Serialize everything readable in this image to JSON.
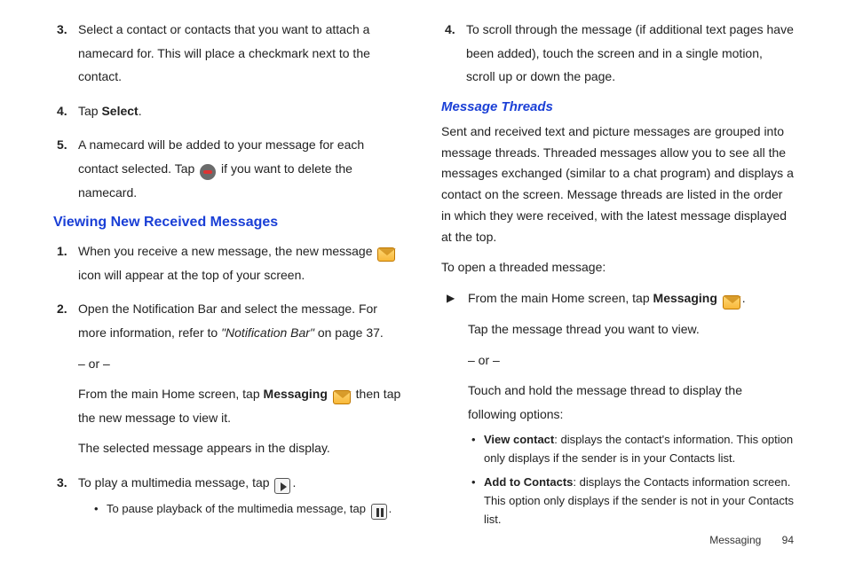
{
  "left": {
    "items123": [
      {
        "num": "3.",
        "text": "Select a contact or contacts that you want to attach a namecard for. This will place a checkmark next to the contact."
      },
      {
        "num": "4.",
        "pre": "Tap ",
        "bold": "Select",
        "post": "."
      },
      {
        "num": "5.",
        "pre": "A namecard will be added to your message for each contact selected. Tap ",
        "post": " if you want to delete the namecard."
      }
    ],
    "heading": "Viewing New Received Messages",
    "view_items": {
      "i1": {
        "num": "1.",
        "pre": "When you receive a new message, the new message ",
        "post": " icon will appear at the top of your screen."
      },
      "i2": {
        "num": "2.",
        "line1a": "Open the Notification Bar and select the message. For more information, refer to ",
        "line1b": "\"Notification Bar\"",
        "line1c": "  on page 37.",
        "or": "– or –",
        "line2a": "From the main Home screen, tap ",
        "line2b": "Messaging",
        "line2c": " then tap the new message to view it.",
        "line3": "The selected message appears in the display."
      },
      "i3": {
        "num": "3.",
        "pre": "To play a multimedia message, tap ",
        "post": ".",
        "bullet_pre": "To pause playback of the multimedia message, tap ",
        "bullet_post": "."
      }
    }
  },
  "right": {
    "item4": {
      "num": "4.",
      "text": "To scroll through the message (if additional text pages have been added), touch the screen and in a single motion, scroll up or down the page."
    },
    "heading": "Message Threads",
    "para1": "Sent and received text and picture messages are grouped into message threads. Threaded messages allow you to see all the messages exchanged (similar to a chat program) and displays a contact on the screen. Message threads are listed in the order in which they were received, with the latest message displayed at the top.",
    "para2": "To open a threaded message:",
    "tri": {
      "line1a": "From the main Home screen, tap ",
      "line1b": "Messaging",
      "line1c": ".",
      "line2": "Tap the message thread you want to view.",
      "or": "– or –",
      "line3": "Touch and hold the message thread to display the following options:"
    },
    "bullets": {
      "b1_bold": "View contact",
      "b1_rest": ": displays the contact's information. This option only displays if the sender is in your Contacts list.",
      "b2_bold": "Add to Contacts",
      "b2_rest": ": displays the Contacts information screen. This option only displays if the sender is not in your Contacts list."
    }
  },
  "footer": {
    "section": "Messaging",
    "page": "94"
  }
}
